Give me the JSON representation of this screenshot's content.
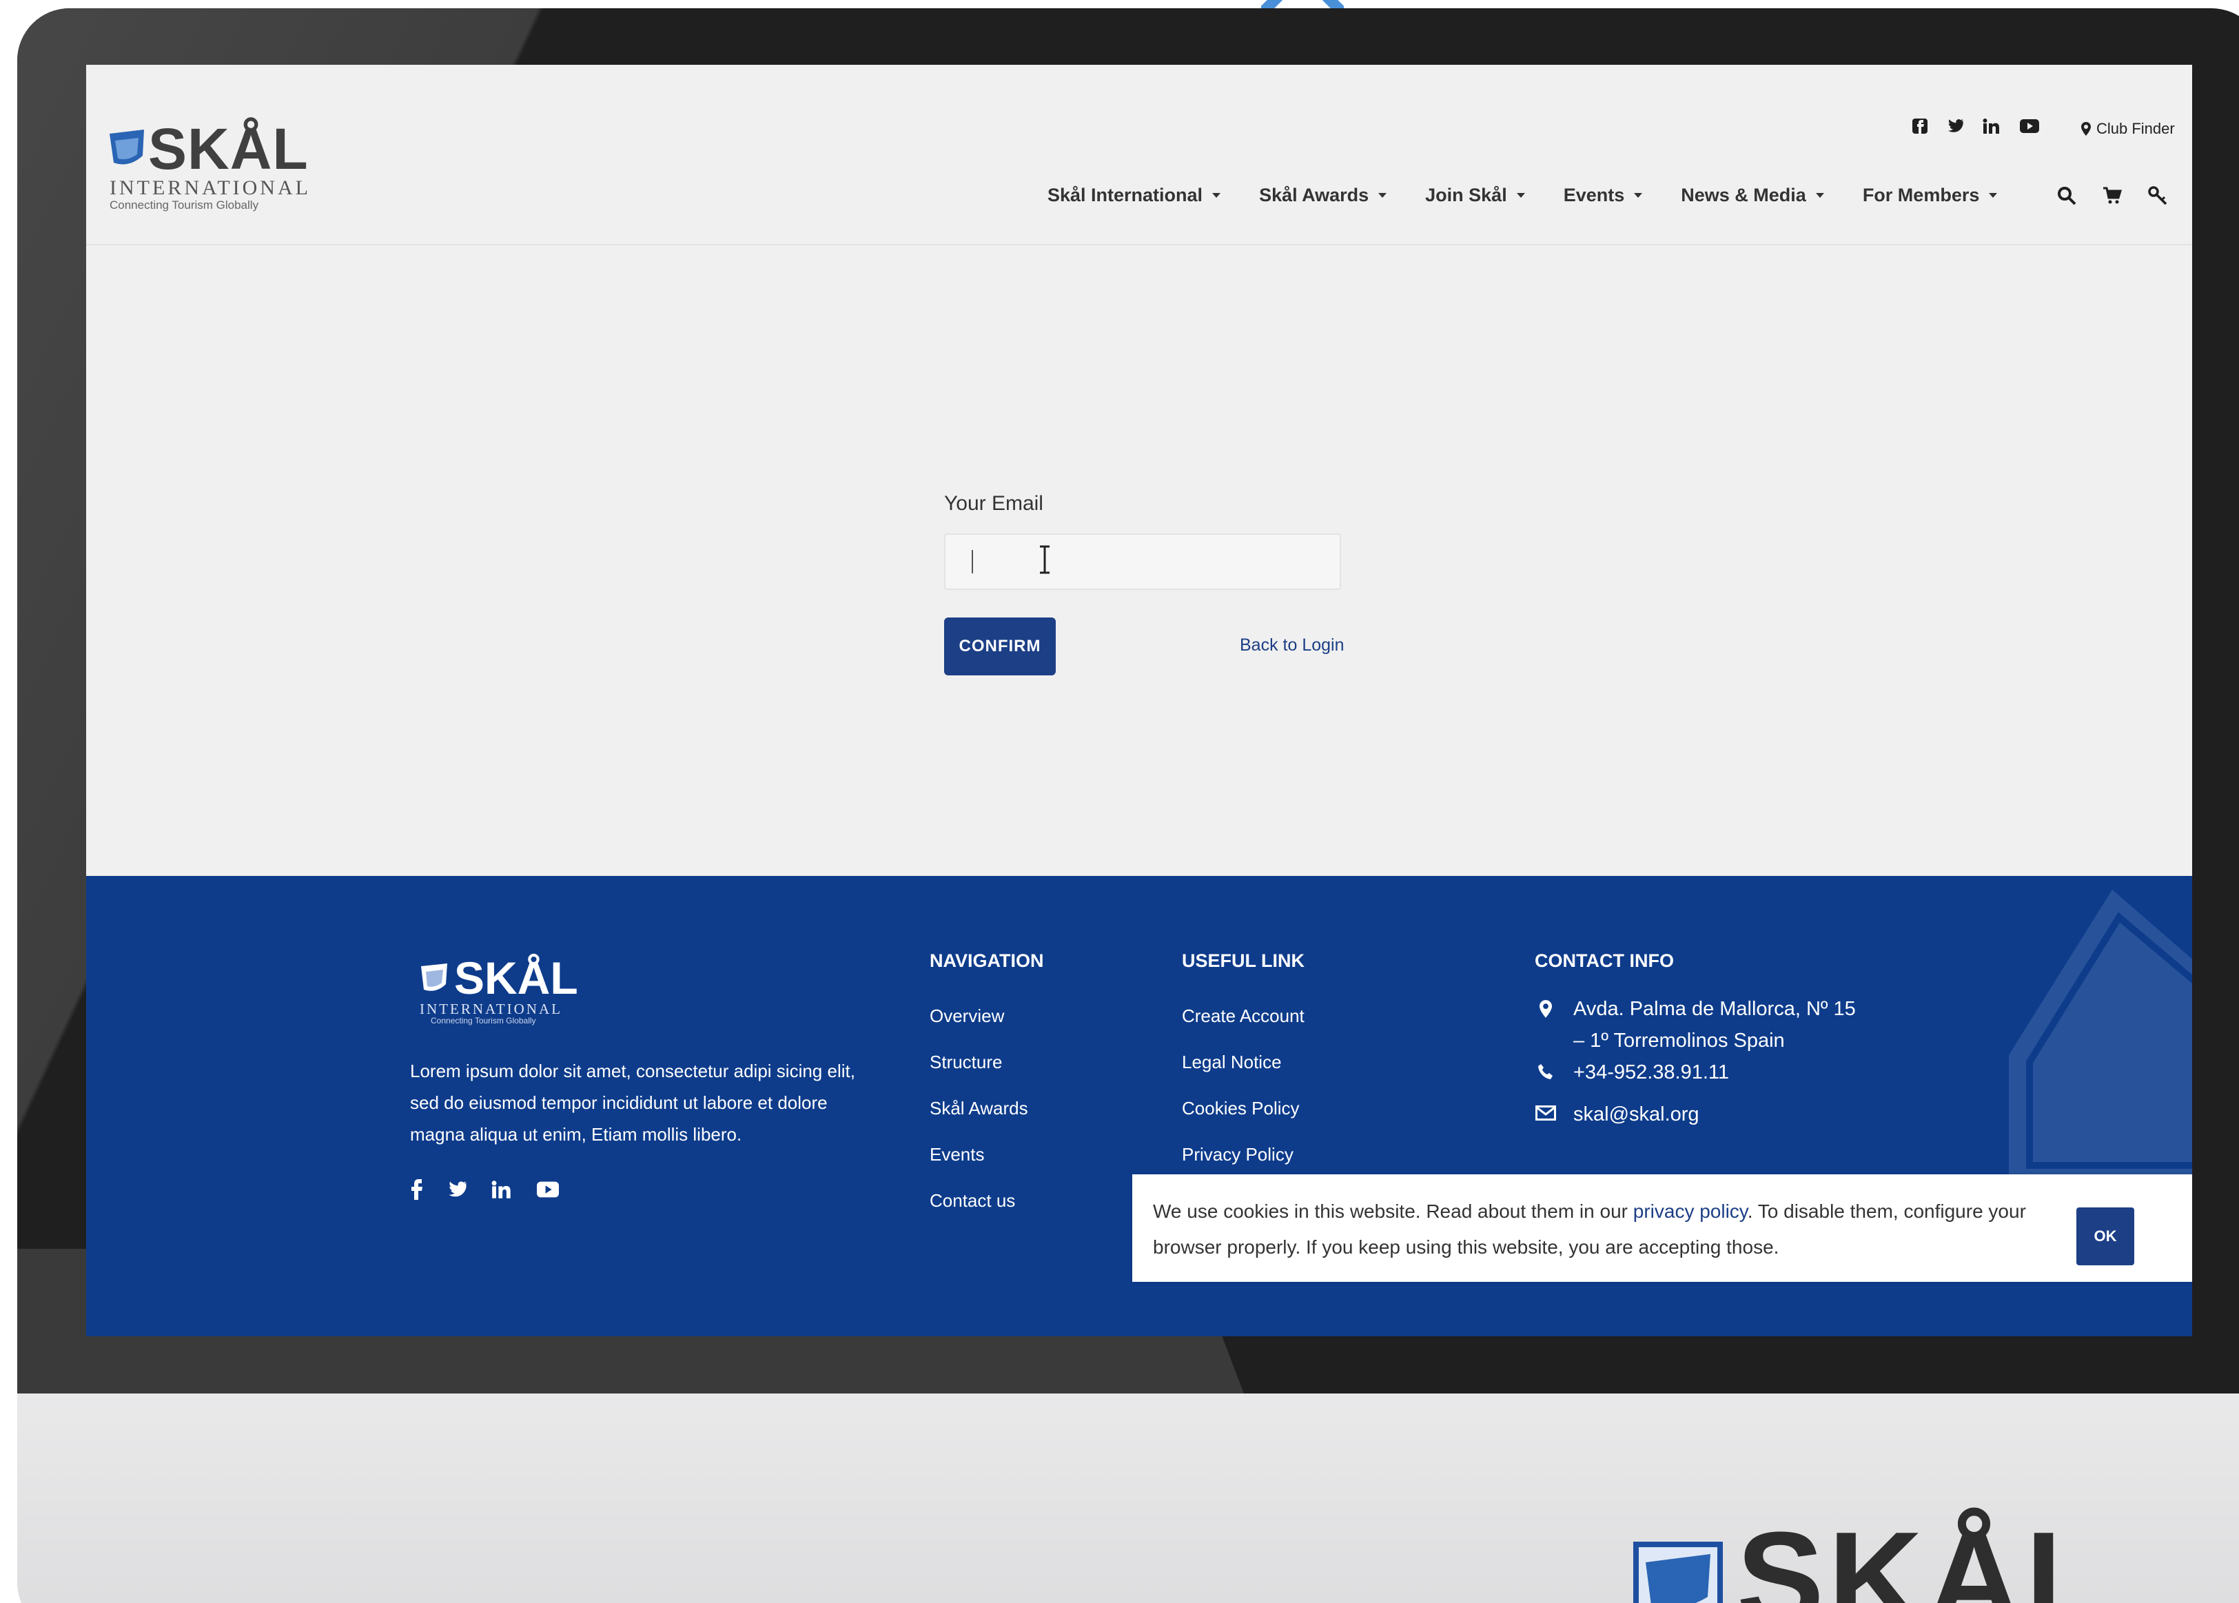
{
  "brand": {
    "name": "SKÅL",
    "sub": "INTERNATIONAL",
    "tagline": "Connecting Tourism Globally",
    "primary_color": "#1c3f86",
    "footer_color": "#0e3c8b"
  },
  "header": {
    "club_finder": "Club Finder",
    "social_icons": [
      "facebook-icon",
      "twitter-icon",
      "linkedin-icon",
      "youtube-icon"
    ],
    "nav": [
      {
        "label": "Skål International"
      },
      {
        "label": "Skål Awards"
      },
      {
        "label": "Join Skål"
      },
      {
        "label": "Events"
      },
      {
        "label": "News & Media"
      },
      {
        "label": "For Members"
      }
    ],
    "tool_icons": [
      "search-icon",
      "cart-icon",
      "key-icon"
    ]
  },
  "form": {
    "email_label": "Your Email",
    "email_value": "",
    "email_placeholder": "",
    "confirm_label": "CONFIRM",
    "back_link": "Back to Login"
  },
  "footer": {
    "logo_word": "SKÅL",
    "logo_sub": "INTERNATIONAL",
    "logo_tag": "Connecting Tourism Globally",
    "description": "Lorem ipsum dolor sit amet, consectetur adipi sicing elit, sed do eiusmod tempor incididunt ut labore et dolore magna aliqua ut enim, Etiam mollis libero.",
    "navigation": {
      "title": "NAVIGATION",
      "items": [
        "Overview",
        "Structure",
        "Skål Awards",
        "Events",
        "Contact us"
      ]
    },
    "useful": {
      "title": "USEFUL LINK",
      "items": [
        "Create Account",
        "Legal Notice",
        "Cookies Policy",
        "Privacy Policy"
      ]
    },
    "contact": {
      "title": "CONTACT INFO",
      "address_line1": "Avda. Palma de Mallorca, Nº 15",
      "address_line2": "– 1º Torremolinos Spain",
      "phone": "+34-952.38.91.11",
      "email": "skal@skal.org"
    }
  },
  "cookie": {
    "text_before": "We use cookies in this website. Read about them in our ",
    "link": "privacy policy",
    "text_after": ". To disable them, configure your browser properly. If you keep using this website, you are accepting those.",
    "ok": "OK"
  },
  "chin_logo": {
    "word": "SKÅL"
  }
}
